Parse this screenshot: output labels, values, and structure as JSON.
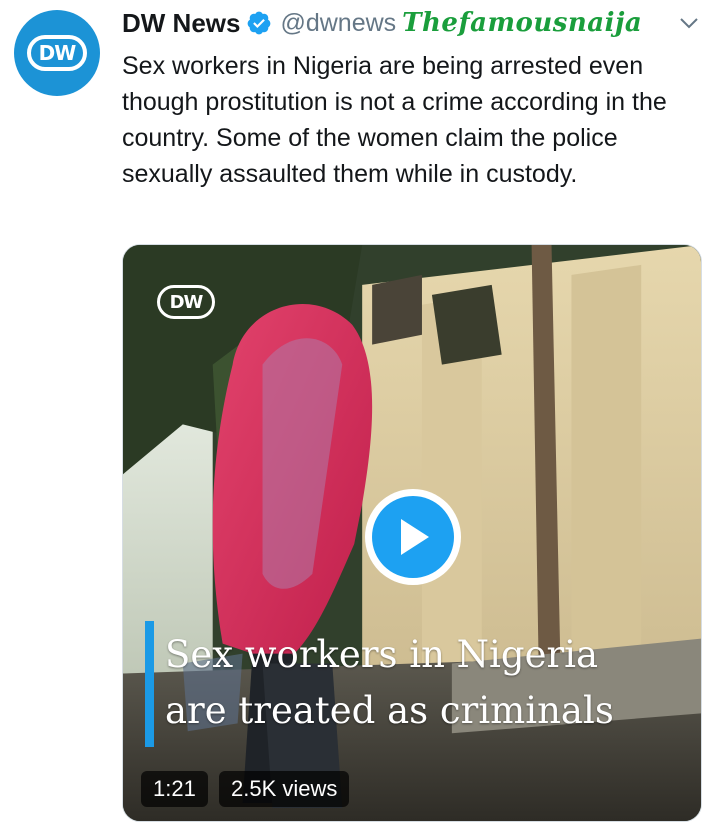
{
  "tweet": {
    "author_name": "DW News",
    "author_handle": "@dwnews",
    "avatar_logo": "DW",
    "verified_icon": "verified-badge-icon",
    "watermark": "Thefamousnaija",
    "text": "Sex workers in Nigeria are  being arrested even though prostitution is not a crime according in the country. Some of the women claim the police sexually assaulted them while in custody."
  },
  "video": {
    "brand_logo": "DW",
    "caption_line1": "Sex workers in Nigeria",
    "caption_line2": "are treated as criminals",
    "duration": "1:21",
    "views": "2.5K views",
    "play_icon": "play-icon"
  },
  "colors": {
    "brand_blue": "#1c93d6",
    "twitter_blue": "#1da1f2",
    "handle_gray": "#657786",
    "watermark_green": "#1a9e3c",
    "caption_accent": "#1b9ae6"
  }
}
